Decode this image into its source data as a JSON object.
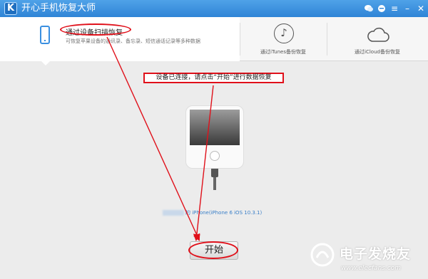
{
  "app": {
    "title": "开心手机恢复大师",
    "logo_letter": "K"
  },
  "titlebar_icons": [
    "wechat-icon",
    "chat-icon",
    "menu-icon",
    "minimize-icon",
    "close-icon"
  ],
  "tabs": [
    {
      "title": "通过设备扫描恢复",
      "desc": "可恢复苹果设备的通讯录、备忘录、短信通话记录等多种数据",
      "icon": "phone-icon",
      "selected": true
    },
    {
      "title": "通过iTunes备份恢复",
      "icon": "music-note-icon",
      "selected": false
    },
    {
      "title": "通过iCloud备份恢复",
      "icon": "cloud-icon",
      "selected": false
    }
  ],
  "main": {
    "message": "设备已连接，请点击“开始”进行数据恢复",
    "device_info": "的 iPhone(iPhone 6 iOS 10.3.1)",
    "start_button": "开始"
  },
  "watermark": {
    "text": "电子发烧友",
    "url": "www.elecfans.com"
  },
  "colors": {
    "accent": "#2f84d6",
    "annotation": "#e0101a",
    "device_text": "#3a7fc8"
  }
}
